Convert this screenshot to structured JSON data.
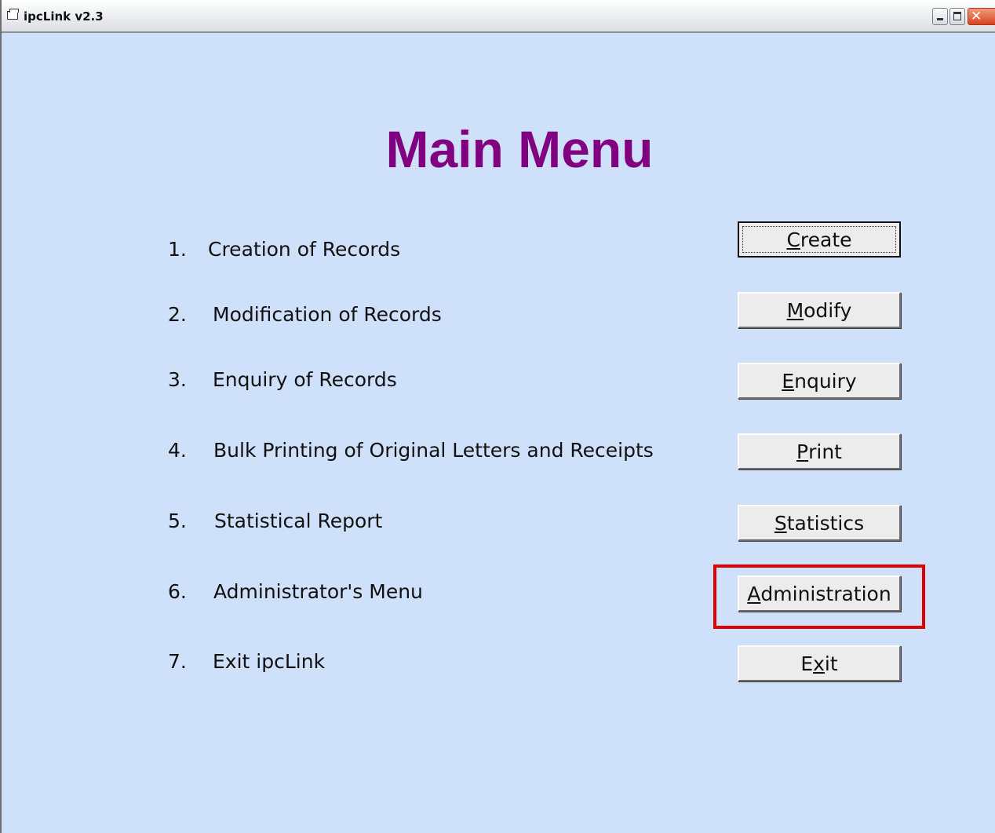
{
  "window": {
    "title": "ipcLink v2.3",
    "close_glyph": "✕"
  },
  "main_title": "Main Menu",
  "menu_items": [
    {
      "number": "1.",
      "label": "Creation of Records",
      "button": {
        "accel": "C",
        "rest": "reate"
      }
    },
    {
      "number": "2.",
      "label": "Modification of Records",
      "button": {
        "accel": "M",
        "rest": "odify"
      }
    },
    {
      "number": "3.",
      "label": "Enquiry of Records",
      "button": {
        "accel": "E",
        "rest": "nquiry"
      }
    },
    {
      "number": "4.",
      "label": "Bulk Printing of Original Letters and Receipts",
      "button": {
        "accel": "P",
        "rest": "rint"
      }
    },
    {
      "number": "5.",
      "label": "Statistical Report",
      "button": {
        "accel": "S",
        "rest": "tatistics"
      }
    },
    {
      "number": "6.",
      "label": "Administrator's Menu",
      "button": {
        "accel": "A",
        "rest": "dministration"
      }
    },
    {
      "number": "7.",
      "label": "Exit ipcLink",
      "button": {
        "pre": "E",
        "accel": "x",
        "rest": "it"
      }
    }
  ],
  "colors": {
    "background": "#cfe0fb",
    "title": "#800080",
    "highlight": "#e00000"
  }
}
